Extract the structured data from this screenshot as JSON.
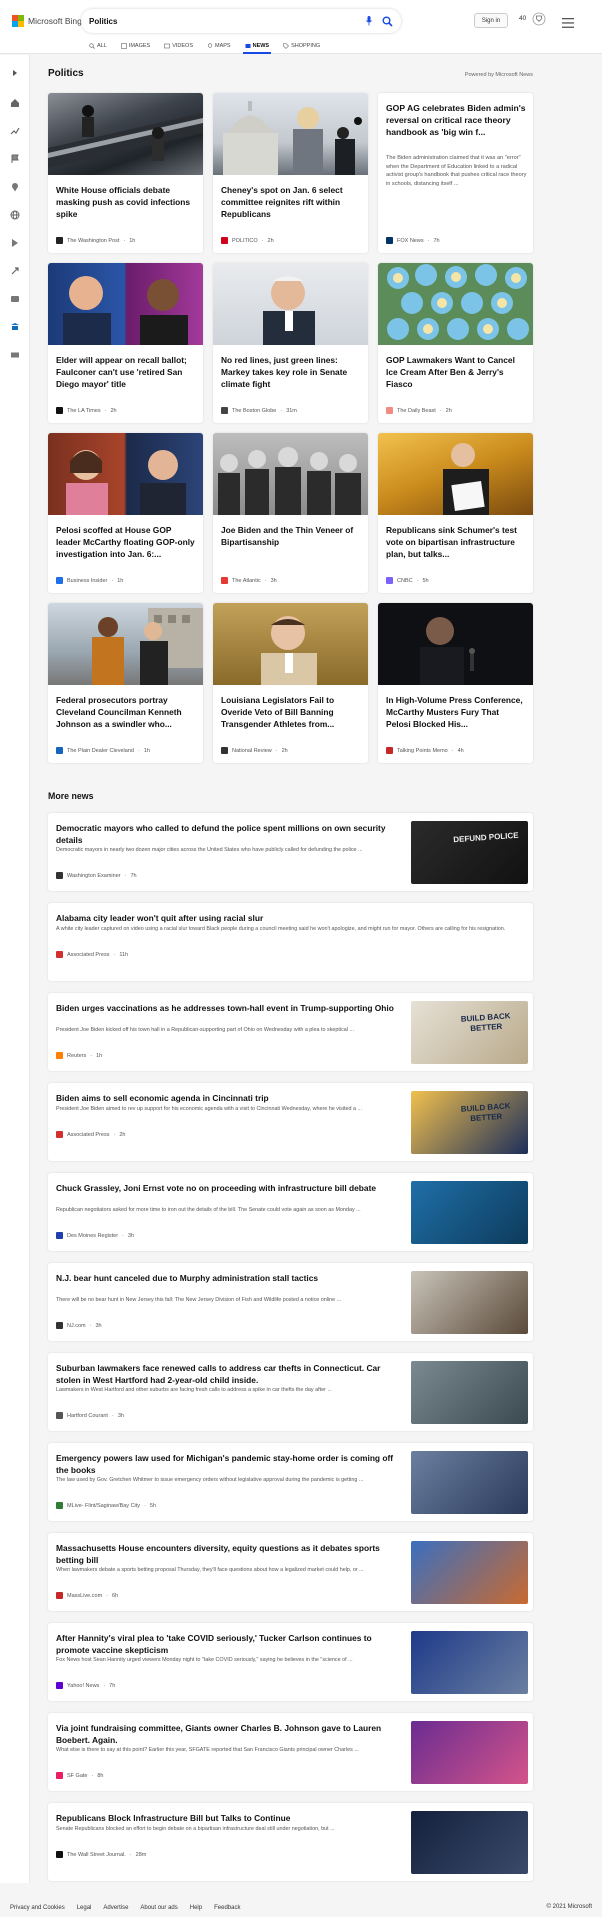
{
  "header": {
    "logo_text": "Microsoft Bing",
    "query": "Politics",
    "sign_in": "Sign in",
    "points": "40",
    "tabs": [
      {
        "label": "ALL",
        "icon": "search-icon"
      },
      {
        "label": "IMAGES",
        "icon": "image-icon"
      },
      {
        "label": "VIDEOS",
        "icon": "video-icon"
      },
      {
        "label": "MAPS",
        "icon": "map-pin-icon"
      },
      {
        "label": "NEWS",
        "icon": "news-icon"
      },
      {
        "label": "SHOPPING",
        "icon": "tag-icon"
      }
    ],
    "active_tab": "NEWS"
  },
  "section": {
    "title": "Politics",
    "powered_by": "Powered by Microsoft News"
  },
  "cards": [
    {
      "title": "White House officials debate masking push as covid infections spike",
      "source": "The Washington Post",
      "age": "1h",
      "favicon_color": "#222222"
    },
    {
      "title": "Cheney's spot on Jan. 6 select committee reignites rift within Republicans",
      "source": "POLITICO",
      "age": "2h",
      "favicon_color": "#d0021b"
    },
    {
      "title": "GOP AG celebrates Biden admin's reversal on critical race theory handbook as 'big win f...",
      "snippet": "The Biden administration claimed that it was an \"error\" when the Department of Education linked to a radical activist group's handbook that pushes critical race theory in schools, distancing itself ...",
      "source": "FOX News",
      "age": "7h",
      "favicon_color": "#003366"
    },
    {
      "title": "Elder will appear on recall ballot; Faulconer can't use 'retired San Diego mayor' title",
      "source": "The LA Times",
      "age": "2h",
      "favicon_color": "#111111"
    },
    {
      "title": "No red lines, just green lines: Markey takes key role in Senate climate fight",
      "source": "The Boston Globe",
      "age": "31m",
      "favicon_color": "#444444"
    },
    {
      "title": "GOP Lawmakers Want to Cancel Ice Cream After Ben & Jerry's Fiasco",
      "source": "The Daily Beast",
      "age": "2h",
      "favicon_color": "#f28b82"
    },
    {
      "title": "Pelosi scoffed at House GOP leader McCarthy floating GOP-only investigation into Jan. 6:...",
      "source": "Business Insider",
      "age": "1h",
      "favicon_color": "#1f6feb"
    },
    {
      "title": "Joe Biden and the Thin Veneer of Bipartisanship",
      "source": "The Atlantic",
      "age": "3h",
      "favicon_color": "#e53935"
    },
    {
      "title": "Republicans sink Schumer's test vote on bipartisan infrastructure plan, but talks...",
      "source": "CNBC",
      "age": "5h",
      "favicon_color": "#7b61ff"
    },
    {
      "title": "Federal prosecutors portray Cleveland Councilman Kenneth Johnson as a swindler who...",
      "source": "The Plain Dealer Cleveland",
      "age": "1h",
      "favicon_color": "#1565c0"
    },
    {
      "title": "Louisiana Legislators Fail to Overide Veto of Bill Banning Transgender Athletes from...",
      "source": "National Review",
      "age": "2h",
      "favicon_color": "#333333"
    },
    {
      "title": "In High-Volume Press Conference, McCarthy Musters Fury That Pelosi Blocked His...",
      "source": "Talking Points Memo",
      "age": "4h",
      "favicon_color": "#c62828"
    }
  ],
  "more_news": {
    "title": "More news",
    "items": [
      {
        "title": "Democratic mayors who called to defund the police spent millions on own security details",
        "snippet": "Democratic mayors in nearly two dozen major cities across the United States who have publicly called for defunding the police ...",
        "source": "Washington Examiner",
        "age": "7h",
        "favicon_color": "#333333",
        "thumb_text": "DEFUND POLICE"
      },
      {
        "title": "Alabama city leader won't quit after using racial slur",
        "snippet": "A white city leader captured on video using a racial slur toward Black people during a council meeting said he won't apologize, and might run for mayor. Others are calling for his resignation.",
        "source": "Associated Press",
        "age": "11h",
        "favicon_color": "#d32f2f"
      },
      {
        "title": "Biden urges vaccinations as he addresses town-hall event in Trump-supporting Ohio",
        "snippet": "President Joe Biden kicked off his town hall in a Republican-supporting part of Ohio on Wednesday with a plea to skeptical ...",
        "source": "Reuters",
        "age": "1h",
        "favicon_color": "#ff8000",
        "thumb_text": "BUILD BACK BETTER"
      },
      {
        "title": "Biden aims to sell economic agenda in Cincinnati trip",
        "snippet": "President Joe Biden aimed to rev up support for his economic agenda with a visit to Cincinnati Wednesday, where he visited a ...",
        "source": "Associated Press",
        "age": "2h",
        "favicon_color": "#d32f2f",
        "thumb_text": "BUILD BACK BETTER"
      },
      {
        "title": "Chuck Grassley, Joni Ernst vote no on proceeding with infrastructure bill debate",
        "snippet": "Republican negotiators asked for more time to iron out the details of the bill. The Senate could vote again as soon as Monday ...",
        "source": "Des Moines Register",
        "age": "3h",
        "favicon_color": "#1e40af"
      },
      {
        "title": "N.J. bear hunt canceled due to Murphy administration stall tactics",
        "snippet": "There will be no bear hunt in New Jersey this fall: The New Jersey Division of Fish and Wildlife posted a notice online ...",
        "source": "NJ.com",
        "age": "3h",
        "favicon_color": "#333333"
      },
      {
        "title": "Suburban lawmakers face renewed calls to address car thefts in Connecticut. Car stolen in West Hartford had 2-year-old child inside.",
        "snippet": "Lawmakers in West Hartford and other suburbs are facing fresh calls to address a spike in car thefts the day after ...",
        "source": "Hartford Courant",
        "age": "3h",
        "favicon_color": "#555555"
      },
      {
        "title": "Emergency powers law used for Michigan's pandemic stay-home order is coming off the books",
        "snippet": "The law used by Gov. Gretchen Whitmer to issue emergency orders without legislative approval during the pandemic is getting ...",
        "source": "MLive- Flint/Saginaw/Bay City",
        "age": "5h",
        "favicon_color": "#2e7d32"
      },
      {
        "title": "Massachusetts House encounters diversity, equity questions as it debates sports betting bill",
        "snippet": "When lawmakers debate a sports betting proposal Thursday, they'll face questions about how a legalized market could help, or ...",
        "source": "MassLive.com",
        "age": "6h",
        "favicon_color": "#c62828"
      },
      {
        "title": "After Hannity's viral plea to 'take COVID seriously,' Tucker Carlson continues to promote vaccine skepticism",
        "snippet": "Fox News host Sean Hannity urged viewers Monday night to \"take COVID seriously,\" saying he believes in the \"science of ...",
        "source": "Yahoo! News",
        "age": "7h",
        "favicon_color": "#6001d2"
      },
      {
        "title": "Via joint fundraising committee, Giants owner Charles B. Johnson gave to Lauren Boebert. Again.",
        "snippet": "What else is there to say at this point? Earlier this year, SFGATE reported that San Francisco Giants principal owner Charles ...",
        "source": "SF Gate",
        "age": "8h",
        "favicon_color": "#e91e63"
      },
      {
        "title": "Republicans Block Infrastructure Bill but Talks to Continue",
        "snippet": "Senate Republicans blocked an effort to begin debate on a bipartisan infrastructure deal still under negotiation, but ...",
        "source": "The Wall Street Journal.",
        "age": "28m",
        "favicon_color": "#111111"
      }
    ]
  },
  "footer": {
    "links": [
      "Privacy and Cookies",
      "Legal",
      "Advertise",
      "About our ads",
      "Help",
      "Feedback"
    ],
    "copyright": "© 2021 Microsoft"
  },
  "colors": {
    "accent": "#174ae4",
    "brand_blue": "#0078d4"
  }
}
